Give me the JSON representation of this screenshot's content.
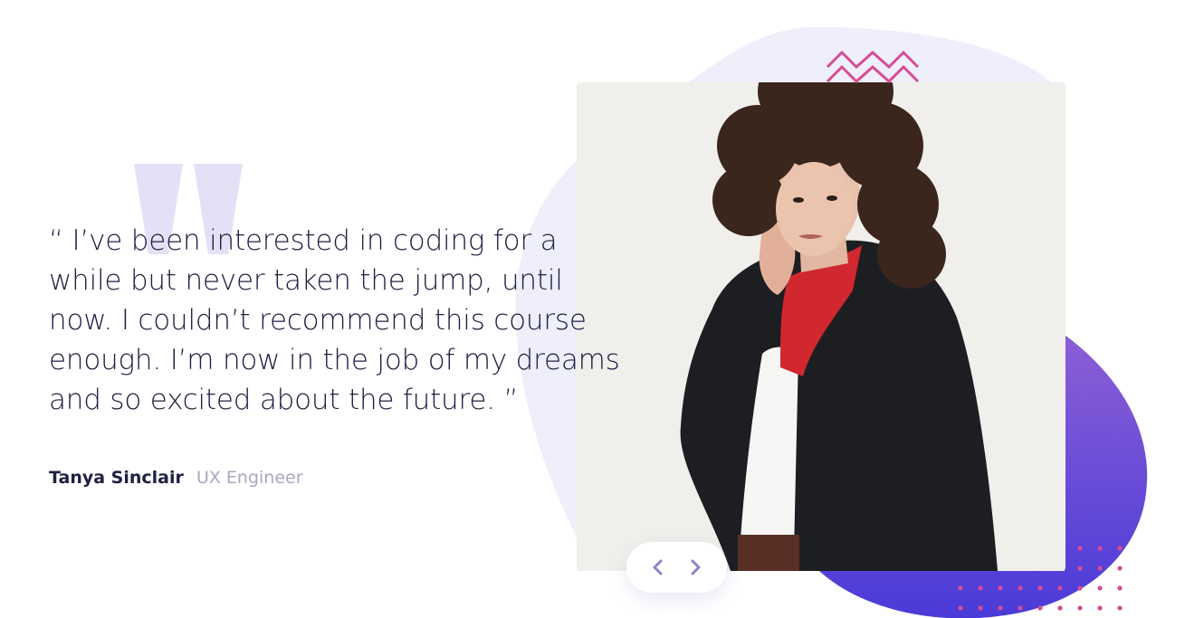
{
  "testimonial": {
    "quote": "“ I’ve been interested in coding for a while but never taken the jump, until now. I couldn’t recommend this course enough. I’m now in the job of my dreams and so excited about the future. ”",
    "author_name": "Tanya Sinclair",
    "author_role": "UX Engineer"
  },
  "slider": {
    "prev_icon": "chevron-left-icon",
    "next_icon": "chevron-right-icon"
  },
  "colors": {
    "text_dark": "#202043",
    "text_muted": "#a8a8c4",
    "accent_purple": "#6b49e0",
    "accent_pink": "#d54c95",
    "blob_light": "#efeefb"
  }
}
